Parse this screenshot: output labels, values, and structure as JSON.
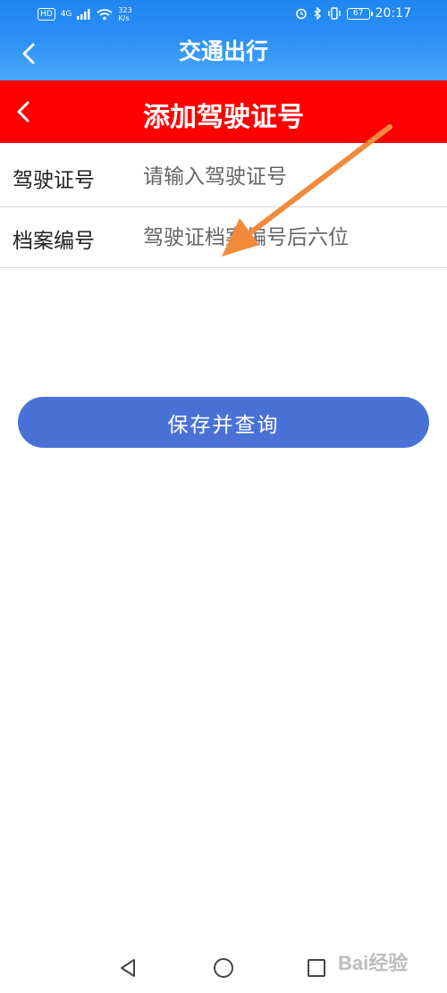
{
  "status_bar": {
    "hd": "HD",
    "net": "4G",
    "speed": "323 K/s",
    "battery": "67",
    "time": "20:17"
  },
  "app_bar": {
    "title": "交通出行"
  },
  "sub_bar": {
    "title": "添加驾驶证号"
  },
  "form": {
    "license_label": "驾驶证号",
    "license_placeholder": "请输入驾驶证号",
    "license_value": "",
    "file_label": "档案编号",
    "file_placeholder": "驾驶证档案编号后六位",
    "file_value": ""
  },
  "save_button": {
    "label": "保存并查询"
  },
  "watermark": {
    "text": "Bai经验"
  },
  "colors": {
    "app_bar": "#2a8ff5",
    "sub_bar": "#ff0000",
    "button": "#4a72d6",
    "arrow": "#f28a3c"
  }
}
